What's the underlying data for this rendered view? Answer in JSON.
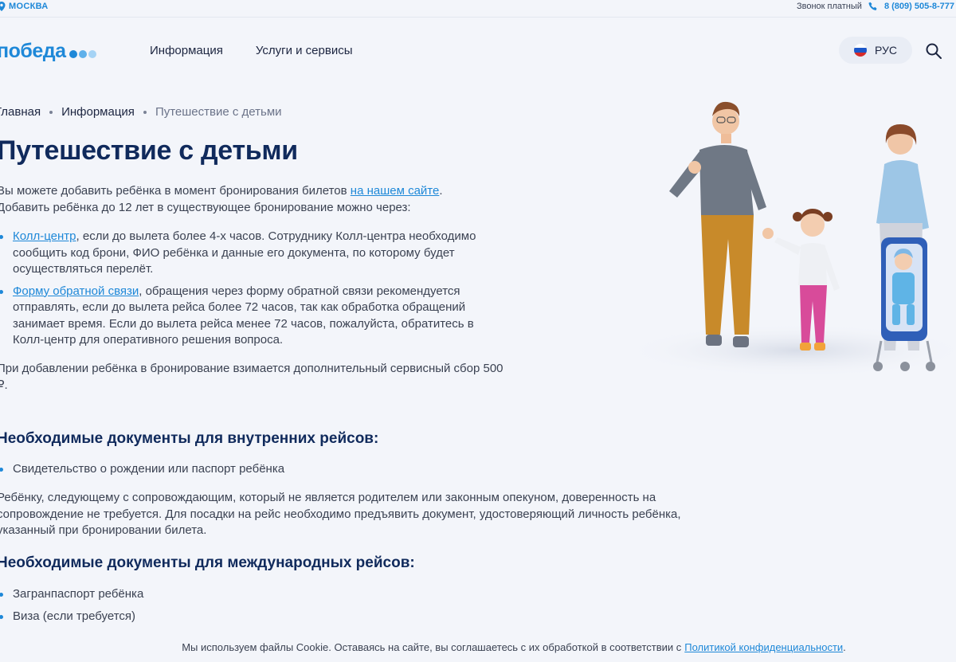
{
  "topbar": {
    "city": "МОСКВА",
    "phone_note": "Звонок платный",
    "phone_number": "8 (809) 505-8-777"
  },
  "header": {
    "logo_text": "победа",
    "nav": [
      "Информация",
      "Услуги и сервисы"
    ],
    "lang": "РУС"
  },
  "breadcrumb": [
    "Главная",
    "Информация",
    "Путешествие с детьми"
  ],
  "page_title": "Путешествие с детьми",
  "intro": {
    "before_link": "Вы можете добавить ребёнка в момент бронирования билетов ",
    "link": "на нашем сайте",
    "after_link": ". Добавить ребёнка до 12 лет в существующее бронирование можно через:"
  },
  "options": [
    {
      "link": "Колл-центр",
      "text": ", если до вылета более 4-х часов. Сотруднику Колл-центра необходимо сообщить код брони, ФИО ребёнка и данные его документа, по которому будет осуществляться перелёт."
    },
    {
      "link": "Форму обратной связи",
      "text": ", обращения через форму обратной связи рекомендуется отправлять, если до вылета рейса более 72 часов, так как обработка обращений занимает время. Если до вылета рейса менее 72 часов, пожалуйста, обратитесь в Колл-центр для оперативного решения вопроса."
    }
  ],
  "fee_note": "При добавлении ребёнка в бронирование взимается дополнительный сервисный сбор 500 ₽.",
  "domestic": {
    "heading": "Необходимые документы для внутренних рейсов:",
    "items": [
      "Свидетельство о рождении или паспорт ребёнка"
    ],
    "note": "Ребёнку, следующему с сопровождающим, который не является родителем или законным опекуном, доверенность на сопровождение не требуется. Для посадки на рейс необходимо предъявить документ, удостоверяющий личность ребёнка, указанный при бронировании билета."
  },
  "international": {
    "heading": "Необходимые документы для международных рейсов:",
    "items": [
      "Загранпаспорт ребёнка",
      "Виза (если требуется)"
    ]
  },
  "cookie": {
    "text": "Мы используем файлы Cookie. Оставаясь на сайте, вы соглашаетесь с их обработкой в соответствии с",
    "link": "Политикой конфиденциальности",
    "end": "."
  },
  "colors": {
    "brand": "#1e88d8",
    "title": "#102a5c",
    "background": "#f3f5fa"
  },
  "icons": [
    "location-pin-icon",
    "phone-icon",
    "russia-flag-icon",
    "search-icon"
  ]
}
